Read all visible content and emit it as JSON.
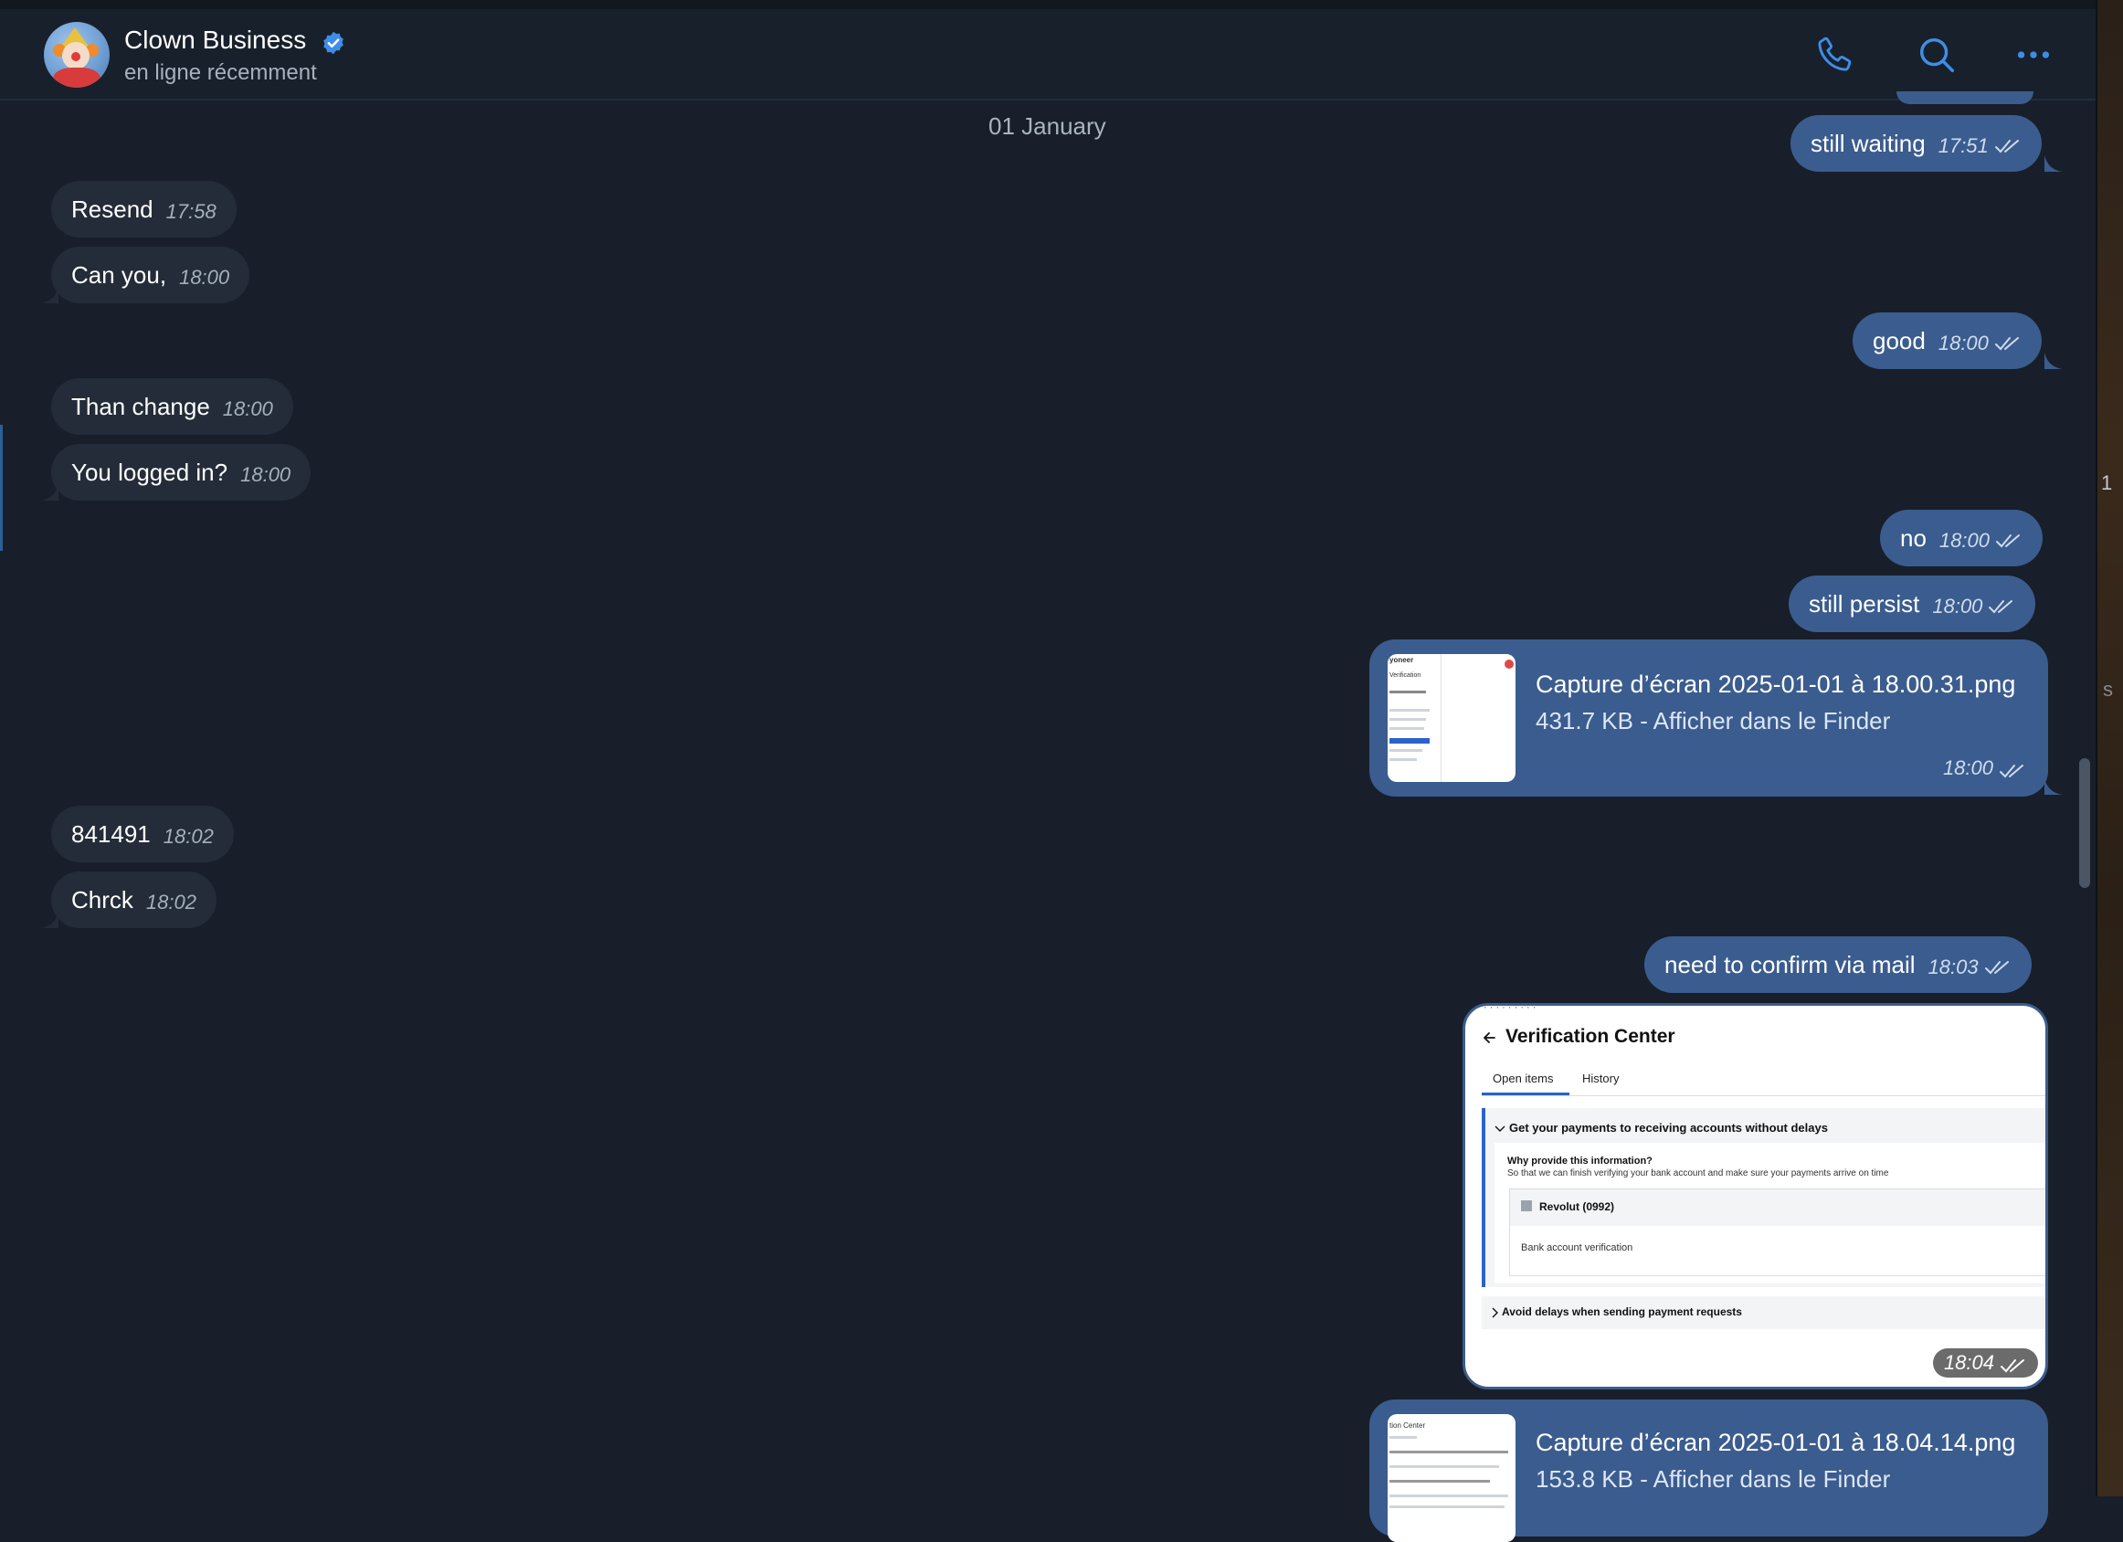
{
  "header": {
    "name": "Clown Business",
    "status": "en ligne récemment",
    "icons": [
      "phone-icon",
      "search-icon",
      "more-icon"
    ]
  },
  "date_separator": "01 January",
  "messages": {
    "m1": {
      "text": "still waiting",
      "time": "17:51",
      "direction": "out",
      "read": true
    },
    "m2": {
      "text": "Resend",
      "time": "17:58",
      "direction": "in"
    },
    "m3": {
      "text": "Can you,",
      "time": "18:00",
      "direction": "in"
    },
    "m4": {
      "text": "good",
      "time": "18:00",
      "direction": "out",
      "read": true
    },
    "m5": {
      "text": "Than change",
      "time": "18:00",
      "direction": "in"
    },
    "m6": {
      "text": "You logged in?",
      "time": "18:00",
      "direction": "in"
    },
    "m7": {
      "text": "no",
      "time": "18:00",
      "direction": "out",
      "read": true
    },
    "m8": {
      "text": "still persist",
      "time": "18:00",
      "direction": "out",
      "read": true
    },
    "f1": {
      "filename": "Capture d’écran 2025-01-01 à 18.00.31.png",
      "meta": "431.7 KB - Afficher dans le Finder",
      "time": "18:00",
      "direction": "out",
      "read": true
    },
    "m9": {
      "text": "841491",
      "time": "18:02",
      "direction": "in"
    },
    "m10": {
      "text": "Chrck",
      "time": "18:02",
      "direction": "in"
    },
    "m11": {
      "text": "need to confirm via mail",
      "time": "18:03",
      "direction": "out",
      "read": true
    },
    "img1": {
      "time": "18:04",
      "direction": "out",
      "read": true
    },
    "f2": {
      "filename": "Capture d’écran 2025-01-01 à 18.04.14.png",
      "meta": "153.8 KB - Afficher dans le Finder",
      "direction": "out"
    }
  },
  "verification_screenshot": {
    "title": "Verification Center",
    "tabs": [
      "Open items",
      "History"
    ],
    "section1": "Get your payments to receiving accounts without delays",
    "why": "Why provide this information?",
    "so": "So that we can finish verifying your bank account and make sure your payments arrive on time",
    "account": "Revolut (0992)",
    "account_task": "Bank account verification",
    "section2": "Avoid delays when sending payment requests"
  },
  "thumb1": {
    "brand": "yoneer",
    "label": "Verification"
  },
  "thumb2": {
    "label": "tion Center"
  },
  "desktop_edge": {
    "g1": "1",
    "g2": "s"
  },
  "colors": {
    "background": "#181f2a",
    "incoming": "#232c38",
    "outgoing": "#3b5c8e",
    "accent": "#3e8ee8"
  }
}
